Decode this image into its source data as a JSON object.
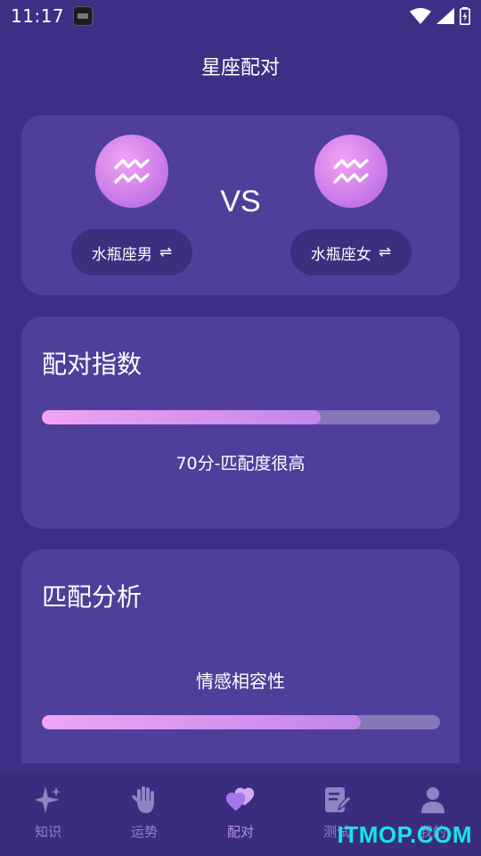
{
  "status_bar": {
    "time": "11:17"
  },
  "app": {
    "title": "星座配对"
  },
  "match": {
    "left_sign_label": "水瓶座男",
    "right_sign_label": "水瓶座女",
    "vs": "VS",
    "swap_symbol": "⇌"
  },
  "index_card": {
    "title": "配对指数",
    "score_fraction": 0.7,
    "score_text": "70分-匹配度很高"
  },
  "analysis_card": {
    "title": "匹配分析",
    "items": [
      {
        "label": "情感相容性",
        "fraction": 0.8
      }
    ]
  },
  "nav": {
    "items": [
      {
        "label": "知识",
        "icon": "sparkle-icon"
      },
      {
        "label": "运势",
        "icon": "palm-icon"
      },
      {
        "label": "配对",
        "icon": "hearts-icon"
      },
      {
        "label": "测试",
        "icon": "note-edit-icon"
      },
      {
        "label": "我的",
        "icon": "user-icon"
      }
    ],
    "active_index": 2
  },
  "watermark": "ITMOP.COM",
  "colors": {
    "background": "#3e2f86",
    "card": "#4f3f9b",
    "accent_pink": "#f0a4f4",
    "active_nav": "#b48ef2",
    "watermark": "#17e5e8"
  }
}
